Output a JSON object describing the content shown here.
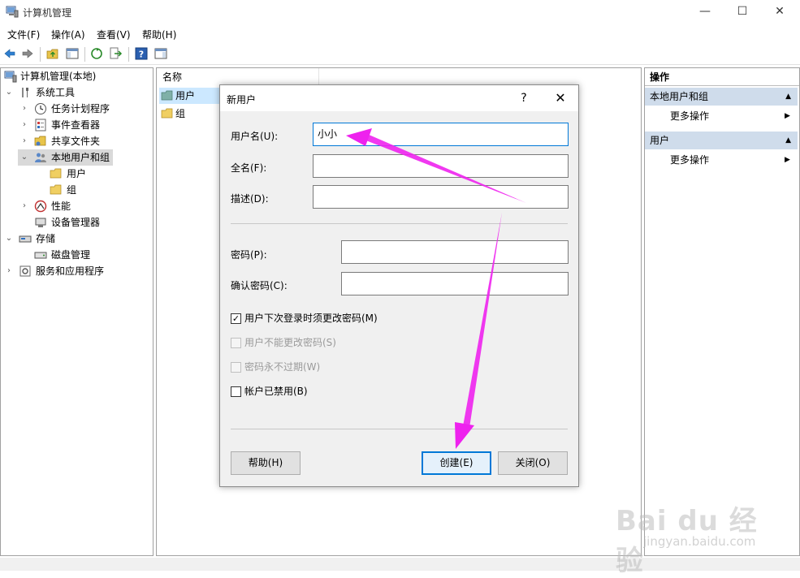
{
  "window": {
    "title": "计算机管理",
    "minimize": "—",
    "maximize": "☐",
    "close": "✕"
  },
  "menu": [
    "文件(F)",
    "操作(A)",
    "查看(V)",
    "帮助(H)"
  ],
  "tree": {
    "items": [
      {
        "label": "计算机管理(本地)",
        "chevron": ""
      },
      {
        "label": "系统工具",
        "chevron": "⌄"
      },
      {
        "label": "任务计划程序",
        "chevron": "›"
      },
      {
        "label": "事件查看器",
        "chevron": "›"
      },
      {
        "label": "共享文件夹",
        "chevron": "›"
      },
      {
        "label": "本地用户和组",
        "chevron": "⌄"
      },
      {
        "label": "用户",
        "chevron": ""
      },
      {
        "label": "组",
        "chevron": ""
      },
      {
        "label": "性能",
        "chevron": "›"
      },
      {
        "label": "设备管理器",
        "chevron": ""
      },
      {
        "label": "存储",
        "chevron": "⌄"
      },
      {
        "label": "磁盘管理",
        "chevron": ""
      },
      {
        "label": "服务和应用程序",
        "chevron": "›"
      }
    ]
  },
  "list": {
    "header": "名称",
    "rows": [
      "用户",
      "组"
    ]
  },
  "actions": {
    "title": "操作",
    "sections": [
      {
        "label": "本地用户和组",
        "item": "更多操作"
      },
      {
        "label": "用户",
        "item": "更多操作"
      }
    ],
    "collapse_arrow": "▲",
    "item_arrow": "▶"
  },
  "dialog": {
    "title": "新用户",
    "help_glyph": "?",
    "close_glyph": "✕",
    "fields": {
      "username": {
        "label": "用户名(U):",
        "value": "小小"
      },
      "fullname": {
        "label": "全名(F):",
        "value": ""
      },
      "description": {
        "label": "描述(D):",
        "value": ""
      },
      "password": {
        "label": "密码(P):",
        "value": ""
      },
      "confirm": {
        "label": "确认密码(C):",
        "value": ""
      }
    },
    "checkboxes": [
      {
        "label": "用户下次登录时须更改密码(M)",
        "checked": true,
        "enabled": true
      },
      {
        "label": "用户不能更改密码(S)",
        "checked": false,
        "enabled": false
      },
      {
        "label": "密码永不过期(W)",
        "checked": false,
        "enabled": false
      },
      {
        "label": "帐户已禁用(B)",
        "checked": false,
        "enabled": true
      }
    ],
    "check_glyph": "✓",
    "buttons": {
      "help": "帮助(H)",
      "create": "创建(E)",
      "close": "关闭(O)"
    }
  },
  "watermark": {
    "brand": "Bai du 经验",
    "url": "jingyan.baidu.com"
  },
  "colors": {
    "annotation_arrow": "#ee22ee",
    "focus": "#0078d7",
    "section_bg": "#cfdceb",
    "selection": "#cce8ff"
  }
}
